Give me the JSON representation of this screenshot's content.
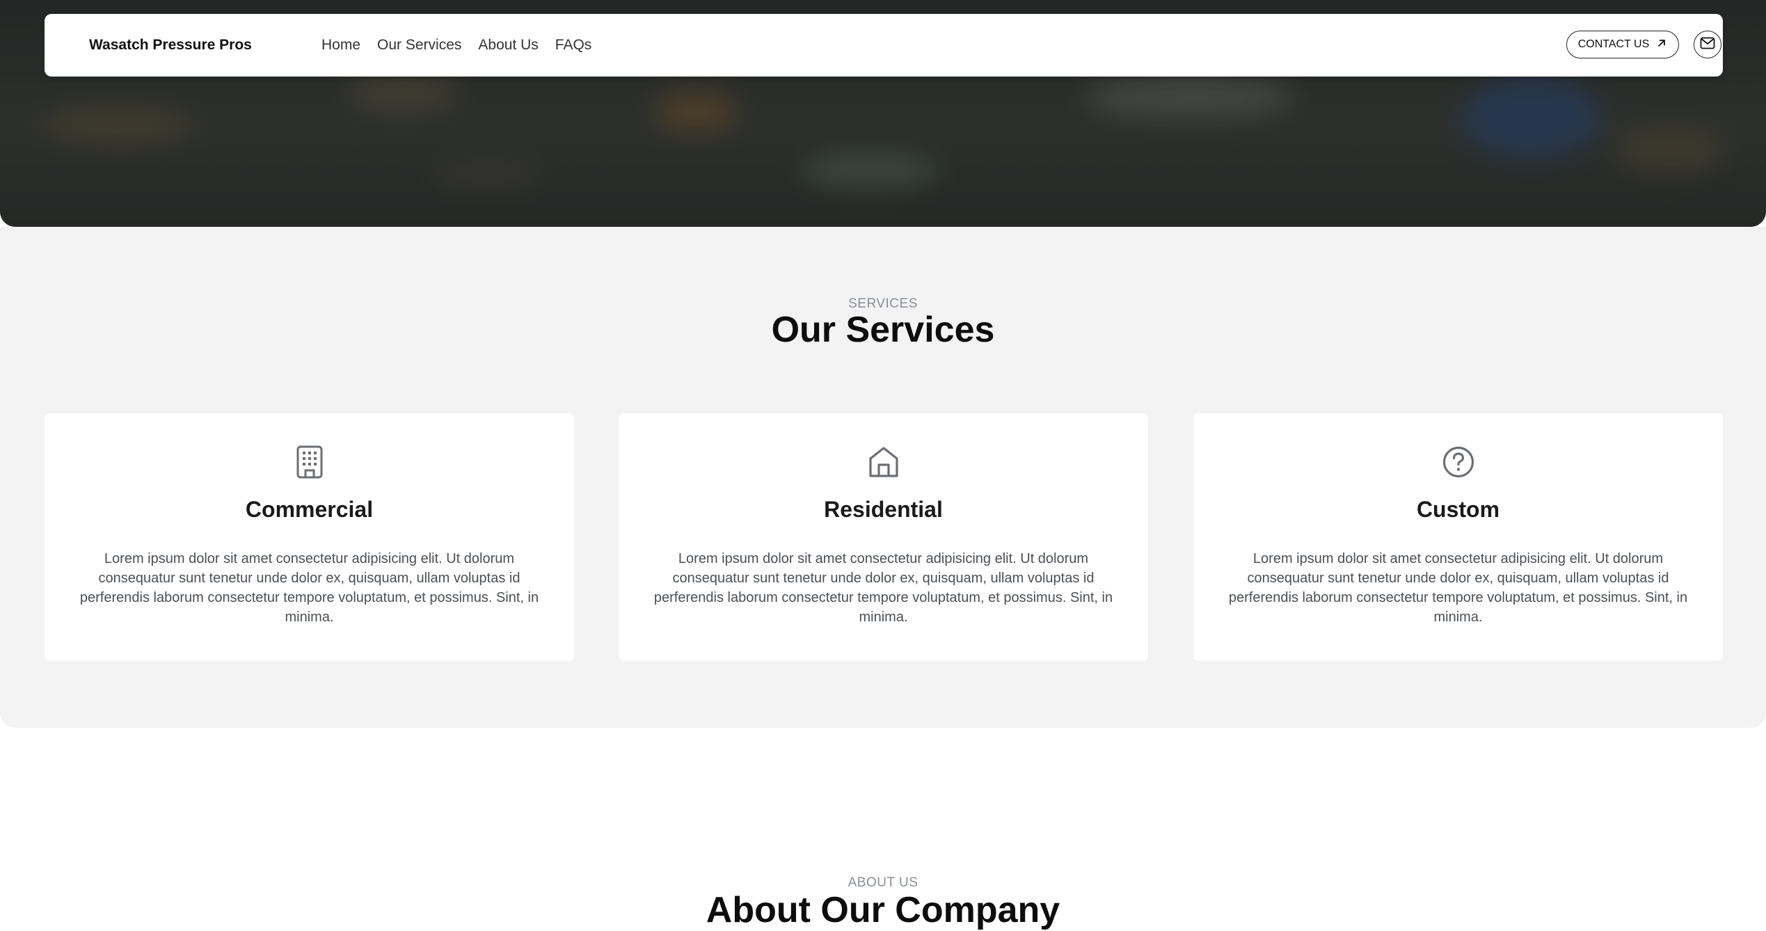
{
  "navbar": {
    "brand": "Wasatch Pressure Pros",
    "links": [
      "Home",
      "Our Services",
      "About Us",
      "FAQs"
    ],
    "contact_label": "CONTACT US"
  },
  "services": {
    "eyebrow": "SERVICES",
    "title": "Our Services",
    "cards": [
      {
        "icon": "building-icon",
        "title": "Commercial",
        "text": "Lorem ipsum dolor sit amet consectetur adipisicing elit. Ut dolorum consequatur sunt tenetur unde dolor ex, quisquam, ullam voluptas id perferendis laborum consectetur tempore voluptatum, et possimus. Sint, in minima."
      },
      {
        "icon": "house-icon",
        "title": "Residential",
        "text": "Lorem ipsum dolor sit amet consectetur adipisicing elit. Ut dolorum consequatur sunt tenetur unde dolor ex, quisquam, ullam voluptas id perferendis laborum consectetur tempore voluptatum, et possimus. Sint, in minima."
      },
      {
        "icon": "question-circle-icon",
        "title": "Custom",
        "text": "Lorem ipsum dolor sit amet consectetur adipisicing elit. Ut dolorum consequatur sunt tenetur unde dolor ex, quisquam, ullam voluptas id perferendis laborum consectetur tempore voluptatum, et possimus. Sint, in minima."
      }
    ]
  },
  "about": {
    "eyebrow": "ABOUT US",
    "title": "About Our Company"
  },
  "colors": {
    "accent": "#111111",
    "section_bg": "#f3f3f3",
    "muted_text": "#8a8f97"
  }
}
